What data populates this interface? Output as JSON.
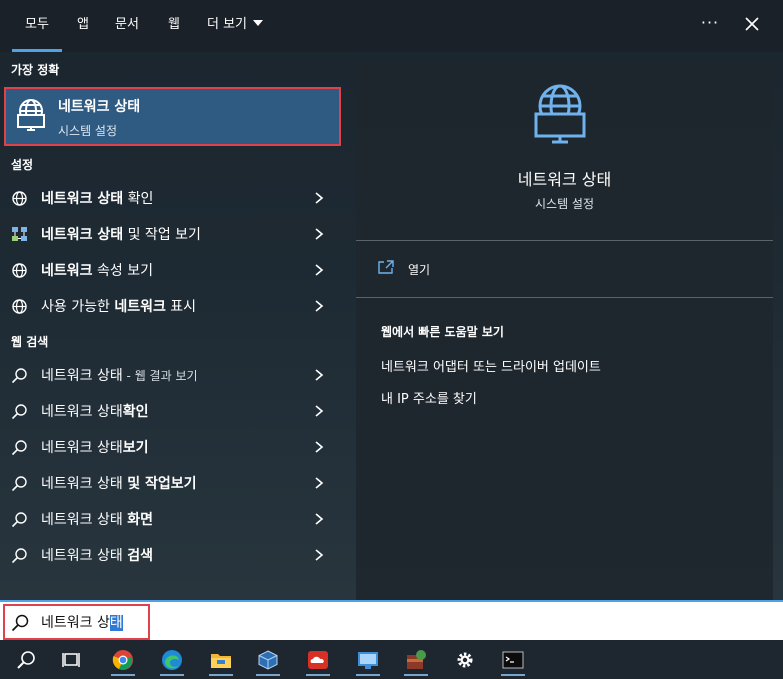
{
  "tabs": [
    {
      "label": "모두",
      "active": true
    },
    {
      "label": "앱"
    },
    {
      "label": "문서"
    },
    {
      "label": "웹"
    },
    {
      "label": "더 보기"
    }
  ],
  "top_actions": {
    "more": "···"
  },
  "best_match": {
    "section": "가장 정확",
    "title": "네트워크 상태",
    "subtitle": "시스템 설정"
  },
  "settings": {
    "section": "설정",
    "items": [
      {
        "bold": "네트워크 상태",
        "rest": " 확인",
        "icon": "globe-icon"
      },
      {
        "bold": "네트워크 상태",
        "rest": " 및 작업 보기",
        "icon": "network-center-icon"
      },
      {
        "bold": "네트워크",
        "rest": " 속성 보기",
        "icon": "globe-icon"
      },
      {
        "pre": "사용 가능한 ",
        "bold": "네트워크",
        "rest": " 표시",
        "icon": "globe-icon"
      }
    ]
  },
  "web_search": {
    "section": "웹 검색",
    "items": [
      {
        "pre": "네트워크 상태",
        "bold": "",
        "suffix": " - 웹 결과 보기"
      },
      {
        "pre": "네트워크 상태",
        "bold": "확인"
      },
      {
        "pre": "네트워크 상태",
        "bold": "보기"
      },
      {
        "pre": "네트워크 상태 ",
        "bold": "및 작업보기"
      },
      {
        "pre": "네트워크 상태 ",
        "bold": "화면"
      },
      {
        "pre": "네트워크 상태 ",
        "bold": "검색"
      }
    ]
  },
  "preview": {
    "title": "네트워크 상태",
    "subtitle": "시스템 설정",
    "open_label": "열기",
    "web_heading": "웹에서 빠른 도움말 보기",
    "links": [
      "네트워크 어댑터 또는 드라이버 업데이트",
      "내 IP 주소를 찾기"
    ]
  },
  "search": {
    "typed": "네트워크 상",
    "selected": "태"
  },
  "taskbar": [
    "search-icon",
    "task-view-icon",
    "chrome-icon",
    "edge-icon",
    "file-explorer-icon",
    "virtualbox-icon",
    "creative-cloud-icon",
    "remote-desktop-icon",
    "winrar-icon",
    "settings-icon",
    "terminal-icon"
  ],
  "colors": {
    "accent": "#4ea3e7",
    "highlight_box": "#e0414b",
    "selected_bg": "#2f5b82"
  }
}
